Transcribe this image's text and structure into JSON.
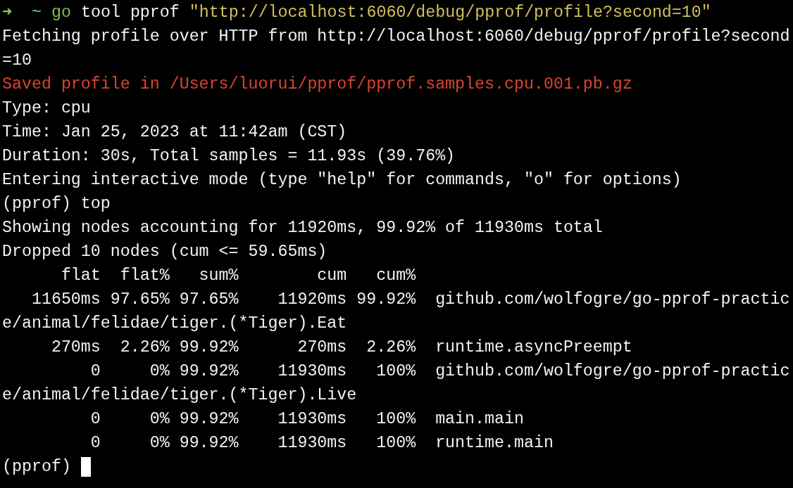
{
  "terminal": {
    "lines": [
      {
        "kind": "shell",
        "segments": [
          {
            "kind": "arrow",
            "text": "➜"
          },
          {
            "kind": "dir",
            "text": "~"
          },
          {
            "kind": "program",
            "text": "go"
          },
          {
            "kind": "plain",
            "text": "tool pprof"
          },
          {
            "kind": "string",
            "text": "\"http://localhost:6060/debug/pprof/profile?second=10\""
          }
        ]
      },
      {
        "kind": "output",
        "text": "Fetching profile over HTTP from http://localhost:6060/debug/pprof/profile?second"
      },
      {
        "kind": "output",
        "text": "=10"
      },
      {
        "kind": "error",
        "text": "Saved profile in /Users/luorui/pprof/pprof.samples.cpu.001.pb.gz"
      },
      {
        "kind": "output",
        "text": "Type: cpu"
      },
      {
        "kind": "output",
        "text": "Time: Jan 25, 2023 at 11:42am (CST)"
      },
      {
        "kind": "output",
        "text": "Duration: 30s, Total samples = 11.93s (39.76%)"
      },
      {
        "kind": "output",
        "text": "Entering interactive mode (type \"help\" for commands, \"o\" for options)"
      },
      {
        "kind": "output",
        "text": "(pprof) top"
      },
      {
        "kind": "output",
        "text": "Showing nodes accounting for 11920ms, 99.92% of 11930ms total"
      },
      {
        "kind": "output",
        "text": "Dropped 10 nodes (cum <= 59.65ms)"
      },
      {
        "kind": "output",
        "text": "      flat  flat%   sum%        cum   cum%"
      },
      {
        "kind": "output",
        "text": "   11650ms 97.65% 97.65%    11920ms 99.92%  github.com/wolfogre/go-pprof-practic"
      },
      {
        "kind": "output",
        "text": "e/animal/felidae/tiger.(*Tiger).Eat"
      },
      {
        "kind": "output",
        "text": "     270ms  2.26% 99.92%      270ms  2.26%  runtime.asyncPreempt"
      },
      {
        "kind": "output",
        "text": "         0     0% 99.92%    11930ms   100%  github.com/wolfogre/go-pprof-practic"
      },
      {
        "kind": "output",
        "text": "e/animal/felidae/tiger.(*Tiger).Live"
      },
      {
        "kind": "output",
        "text": "         0     0% 99.92%    11930ms   100%  main.main"
      },
      {
        "kind": "output",
        "text": "         0     0% 99.92%    11930ms   100%  runtime.main"
      },
      {
        "kind": "cursor",
        "text": "(pprof)"
      }
    ]
  }
}
